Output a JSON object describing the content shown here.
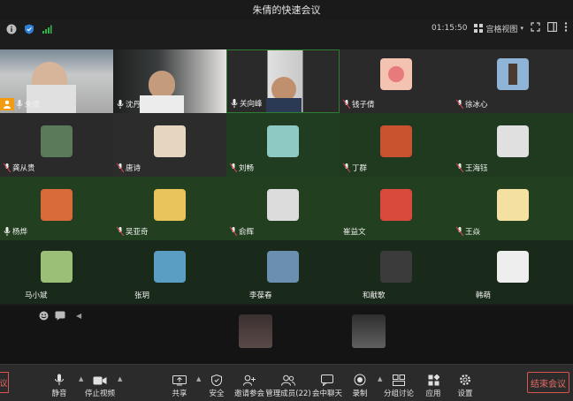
{
  "window": {
    "title": "朱倩的快速会议"
  },
  "status": {
    "timer": "01:15:50",
    "view_mode": "宫格视图"
  },
  "participants": [
    {
      "name": "朱倩"
    },
    {
      "name": "沈丹"
    },
    {
      "name": "关向峰"
    },
    {
      "name": "钱子倩"
    },
    {
      "name": "徐冰心"
    },
    {
      "name": "龚从贵"
    },
    {
      "name": "唐诗"
    },
    {
      "name": "刘畅"
    },
    {
      "name": "丁群"
    },
    {
      "name": "王海钰"
    },
    {
      "name": "杨烨"
    },
    {
      "name": "吴亚奇"
    },
    {
      "name": "俞辉"
    },
    {
      "name": "崔益文"
    },
    {
      "name": "王焱"
    },
    {
      "name": "马小斌"
    },
    {
      "name": "张玥"
    },
    {
      "name": "李葆春"
    },
    {
      "name": "和献歌"
    },
    {
      "name": "韩萌"
    }
  ],
  "toolbar": {
    "mute": "静音",
    "stop_video": "停止视频",
    "share": "共享",
    "security": "安全",
    "invite": "邀请参会",
    "manage_members": "管理成员(22)",
    "chat": "会中聊天",
    "record": "录制",
    "breakout": "分组讨论",
    "apps": "应用",
    "settings": "设置",
    "end_meeting": "结束会议",
    "left_stub": "议"
  },
  "colors": {
    "accent_green": "#2fb24a",
    "end_red": "#e86a64",
    "active_speaker_border": "#2e7d32"
  }
}
